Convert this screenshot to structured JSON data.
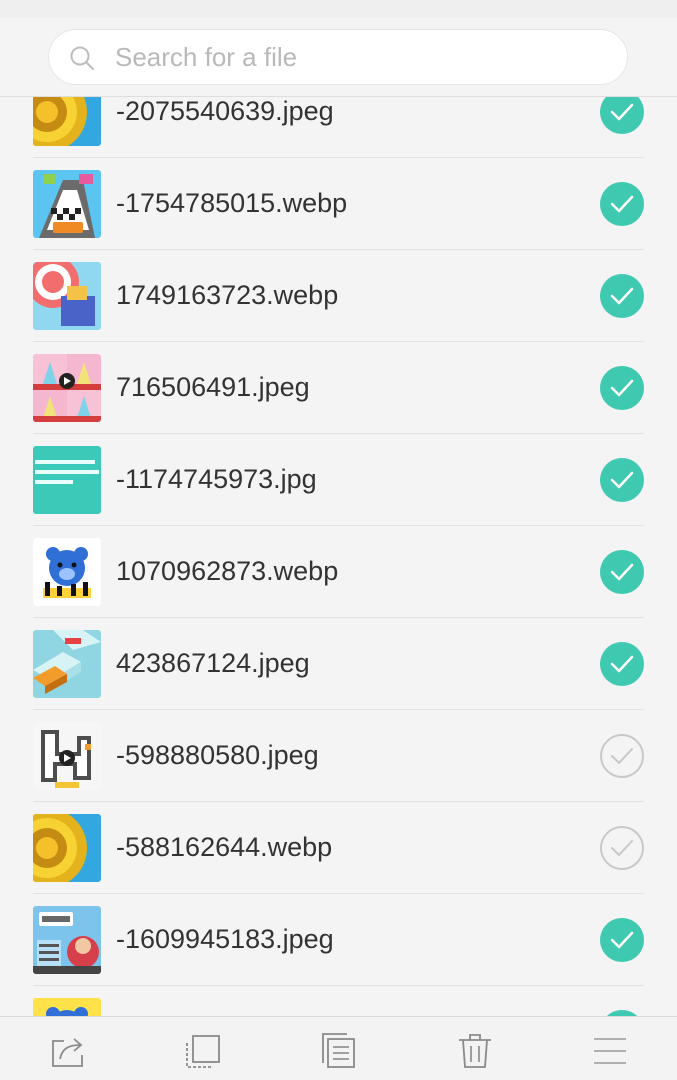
{
  "search": {
    "placeholder": "Search for a file"
  },
  "files": [
    {
      "name": "-2075540639.jpeg",
      "checked": true,
      "thumb": "spiral-yellow"
    },
    {
      "name": "-1754785015.webp",
      "checked": true,
      "thumb": "race-track-open"
    },
    {
      "name": "1749163723.webp",
      "checked": true,
      "thumb": "pink-stairs"
    },
    {
      "name": "716506491.jpeg",
      "checked": true,
      "thumb": "ice-cream-grid"
    },
    {
      "name": "-1174745973.jpg",
      "checked": true,
      "thumb": "teal-text"
    },
    {
      "name": "1070962873.webp",
      "checked": true,
      "thumb": "blue-bear"
    },
    {
      "name": "423867124.jpeg",
      "checked": true,
      "thumb": "tiles-orange"
    },
    {
      "name": "-598880580.jpeg",
      "checked": false,
      "thumb": "maze-video"
    },
    {
      "name": "-588162644.webp",
      "checked": false,
      "thumb": "spiral-yellow"
    },
    {
      "name": "-1609945183.jpeg",
      "checked": true,
      "thumb": "quiz-game"
    },
    {
      "name": "",
      "checked": true,
      "thumb": "blue-bear-partial"
    }
  ],
  "toolbar": {
    "items": [
      "share-icon",
      "select-icon",
      "copy-icon",
      "trash-icon",
      "menu-icon"
    ]
  },
  "colors": {
    "accent": "#3fc9b0",
    "background": "#f4f4f4",
    "text": "#333333",
    "placeholder": "#b9b9b9"
  }
}
